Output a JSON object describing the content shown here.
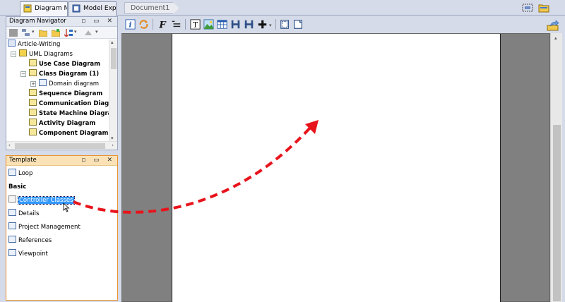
{
  "tabs": {
    "diagram_navigator": "Diagram N...",
    "model_explorer": "Model Exp...",
    "document": "Document1"
  },
  "navigator": {
    "title": "Diagram Navigator",
    "tree": [
      {
        "label": "Article-Writing",
        "bold": false
      },
      {
        "label": "UML Diagrams",
        "bold": false
      },
      {
        "label": "Use Case Diagram",
        "bold": true
      },
      {
        "label": "Class Diagram (1)",
        "bold": true
      },
      {
        "label": "Domain diagram",
        "bold": false
      },
      {
        "label": "Sequence Diagram",
        "bold": true
      },
      {
        "label": "Communication Diagra",
        "bold": true
      },
      {
        "label": "State Machine Diagrar",
        "bold": true
      },
      {
        "label": "Activity Diagram",
        "bold": true
      },
      {
        "label": "Component Diagram",
        "bold": true
      }
    ]
  },
  "template": {
    "title": "Template",
    "items": [
      {
        "label": "Loop",
        "bold": false
      },
      {
        "label": "Basic",
        "bold": true
      },
      {
        "label": "Controller Classes",
        "bold": false,
        "selected": true
      },
      {
        "label": "Details",
        "bold": false
      },
      {
        "label": "Project Management",
        "bold": false
      },
      {
        "label": "References",
        "bold": false
      },
      {
        "label": "Viewpoint",
        "bold": false
      }
    ]
  },
  "panel_controls": "▫ ▭ ✕",
  "colors": {
    "accent_orange": "#e8922c",
    "selection_blue": "#3399ff",
    "arrow_red": "#e8141c",
    "canvas_gray": "#808080"
  },
  "annotation": {
    "description": "dashed red arrow from Controller Classes toward document page"
  }
}
